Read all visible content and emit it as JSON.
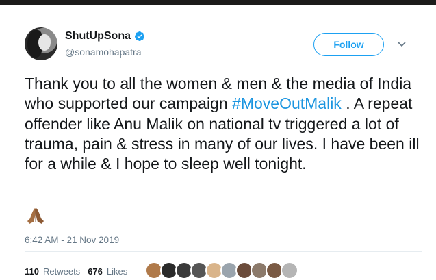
{
  "tweet": {
    "display_name": "ShutUpSona",
    "handle": "@sonamohapatra",
    "verified": true,
    "follow_label": "Follow",
    "text_before": "Thank you to all the women & men & the media of India who supported our campaign ",
    "hashtag": "#MoveOutMalik",
    "text_after": " . A repeat offender like Anu Malik on national tv triggered a lot of trauma, pain & stress in many of our lives. I have been ill for a while & I hope to sleep well tonight.",
    "emoji": "folded-hands-emoji",
    "timestamp": "6:42 AM - 21 Nov 2019"
  },
  "stats": {
    "retweets_count": "110",
    "retweets_label": "Retweets",
    "likes_count": "676",
    "likes_label": "Likes"
  },
  "likers": [
    {
      "name": "liker-avatar",
      "color": "#b07a4a"
    },
    {
      "name": "liker-avatar",
      "color": "#2a2a2a"
    },
    {
      "name": "liker-avatar",
      "color": "#3a3a3a"
    },
    {
      "name": "liker-avatar",
      "color": "#555555"
    },
    {
      "name": "liker-avatar",
      "color": "#d9b48a"
    },
    {
      "name": "liker-avatar",
      "color": "#9aa4ad"
    },
    {
      "name": "liker-avatar",
      "color": "#6b4c3b"
    },
    {
      "name": "liker-avatar",
      "color": "#8c7a6b"
    },
    {
      "name": "liker-avatar",
      "color": "#7a5a44"
    },
    {
      "name": "liker-avatar",
      "color": "#b5b5b5"
    }
  ],
  "colors": {
    "accent": "#1da1f2",
    "hashtag": "#1b95e0",
    "secondary_text": "#657786"
  }
}
